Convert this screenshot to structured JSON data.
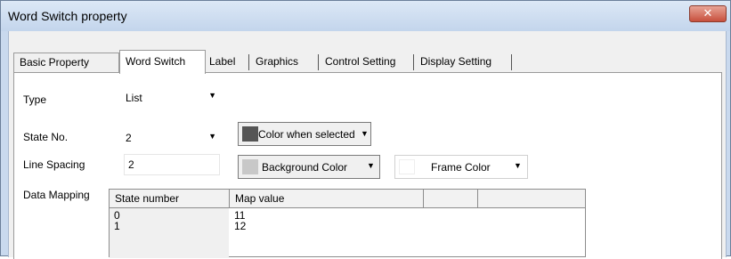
{
  "window": {
    "title": "Word Switch property",
    "close_glyph": "✕"
  },
  "tabs": [
    {
      "label": "Basic Property"
    },
    {
      "label": "Word Switch"
    },
    {
      "label": "Label"
    },
    {
      "label": "Graphics"
    },
    {
      "label": "Control Setting"
    },
    {
      "label": "Display Setting"
    }
  ],
  "form": {
    "type_label": "Type",
    "type_value": "List",
    "state_label": "State No.",
    "state_value": "2",
    "line_spacing_label": "Line Spacing",
    "line_spacing_value": "2",
    "color_selected_label": "Color when selected",
    "color_selected_swatch": "#555555",
    "background_color_label": "Background Color",
    "background_color_swatch": "#c8c8c8",
    "frame_color_label": "Frame Color",
    "frame_color_swatch": "#ffffff",
    "data_mapping_label": "Data Mapping"
  },
  "table": {
    "headers": [
      "State number",
      "Map value"
    ],
    "rows": [
      {
        "state": "0",
        "value": "11"
      },
      {
        "state": "1",
        "value": "12"
      }
    ]
  },
  "icons": {
    "dropdown": "▼"
  }
}
